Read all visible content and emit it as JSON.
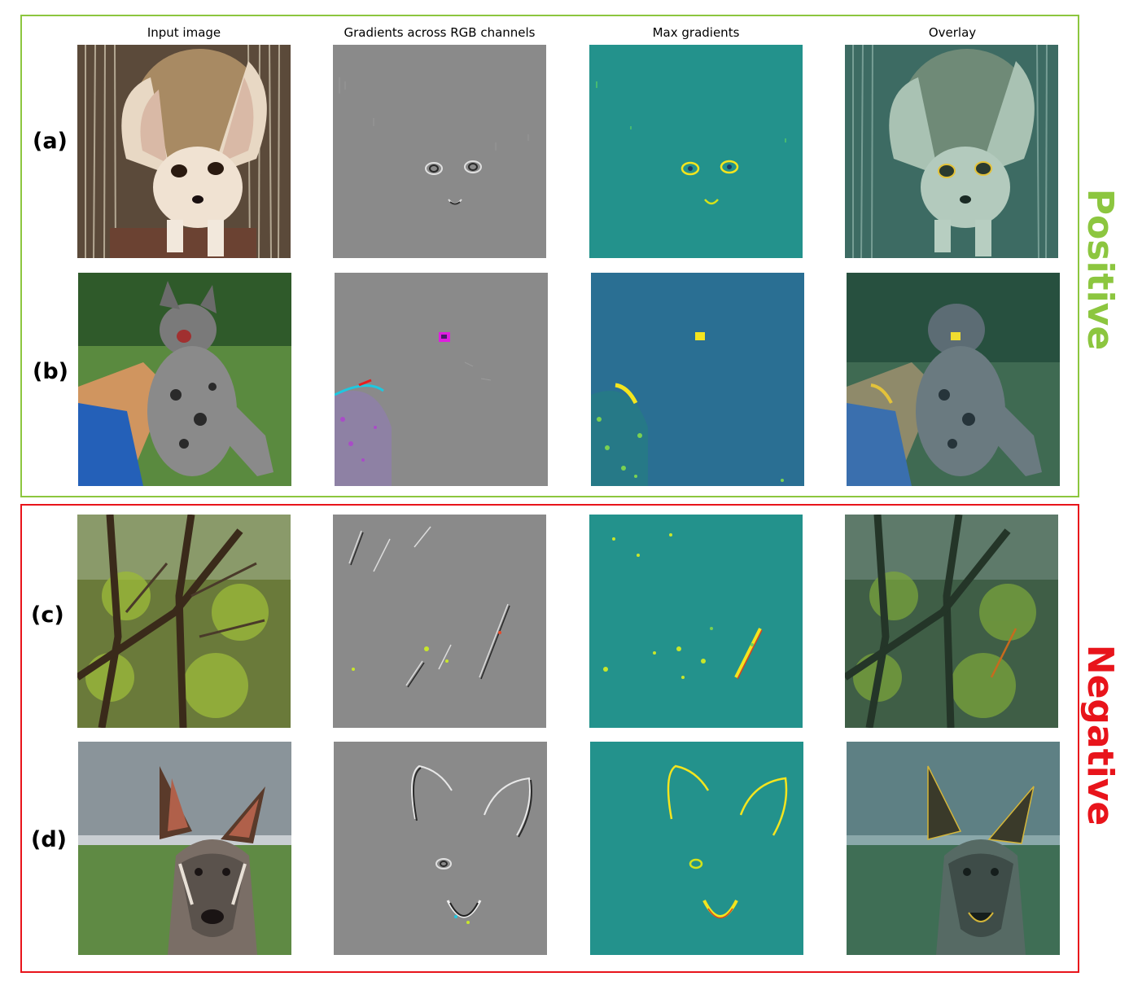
{
  "columns": [
    {
      "title": "Input image"
    },
    {
      "title": "Gradients across RGB channels"
    },
    {
      "title": "Max gradients"
    },
    {
      "title": "Overlay"
    }
  ],
  "rows": [
    {
      "label": "(a)",
      "subject": "fennec fox"
    },
    {
      "label": "(b)",
      "subject": "kitten held in hand"
    },
    {
      "label": "(c)",
      "subject": "trees"
    },
    {
      "label": "(d)",
      "subject": "wallaby"
    }
  ],
  "groups": {
    "positive": {
      "label": "Positive",
      "color": "#8cc63f"
    },
    "negative": {
      "label": "Negative",
      "color": "#e8141b"
    }
  },
  "colors": {
    "gradient_gray": "#8a8a8a",
    "max_grad_teal": "#23928c",
    "max_grad_blue": "#2a6f93",
    "highlight_yellow": "#f4e51e"
  }
}
